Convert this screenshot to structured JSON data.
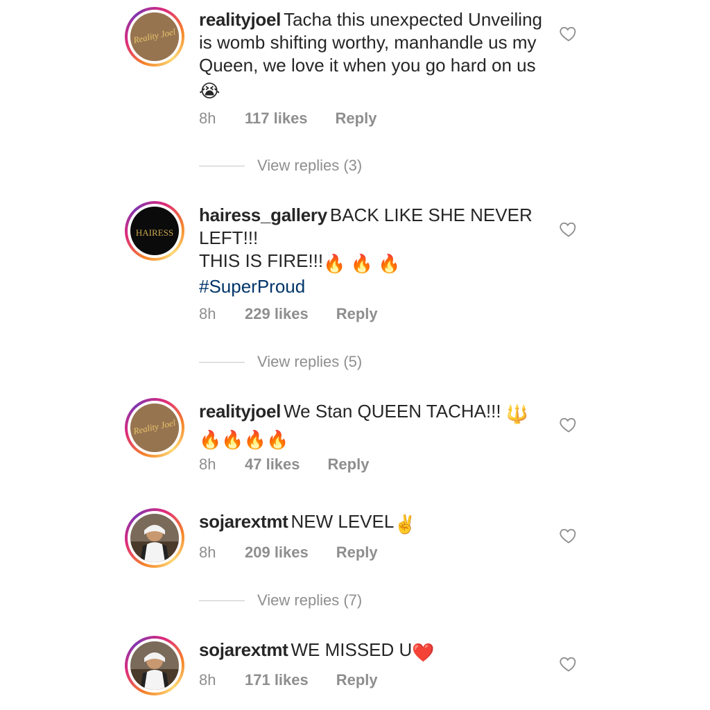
{
  "comments": [
    {
      "username": "realityjoel",
      "text": "Tacha this unexpected Unveiling is womb shifting worthy, manhandle us my Queen, we love it when you go hard on us",
      "emoji": "😭",
      "time": "8h",
      "likes": "117 likes",
      "reply": "Reply",
      "view_replies": "View replies (3)",
      "avatar_logo": "Reality Joel"
    },
    {
      "username": "hairess_gallery",
      "text_line1": "BACK LIKE SHE NEVER LEFT!!!",
      "text_line2": "THIS IS FIRE!!!",
      "emoji": "🔥 🔥 🔥",
      "hashtag": "#SuperProud",
      "time": "8h",
      "likes": "229 likes",
      "reply": "Reply",
      "view_replies": "View replies (5)",
      "avatar_logo": "HAIRESS"
    },
    {
      "username": "realityjoel",
      "text": "We Stan QUEEN TACHA!!!",
      "emoji": "🔱",
      "emoji_line2": "🔥🔥🔥🔥",
      "time": "8h",
      "likes": "47 likes",
      "reply": "Reply",
      "avatar_logo": "Reality Joel"
    },
    {
      "username": "sojarextmt",
      "text": "NEW LEVEL",
      "emoji": "✌️",
      "time": "8h",
      "likes": "209 likes",
      "reply": "Reply",
      "view_replies": "View replies (7)"
    },
    {
      "username": "sojarextmt",
      "text": "WE MISSED U",
      "emoji": "❤️",
      "time": "8h",
      "likes": "171 likes",
      "reply": "Reply"
    }
  ]
}
